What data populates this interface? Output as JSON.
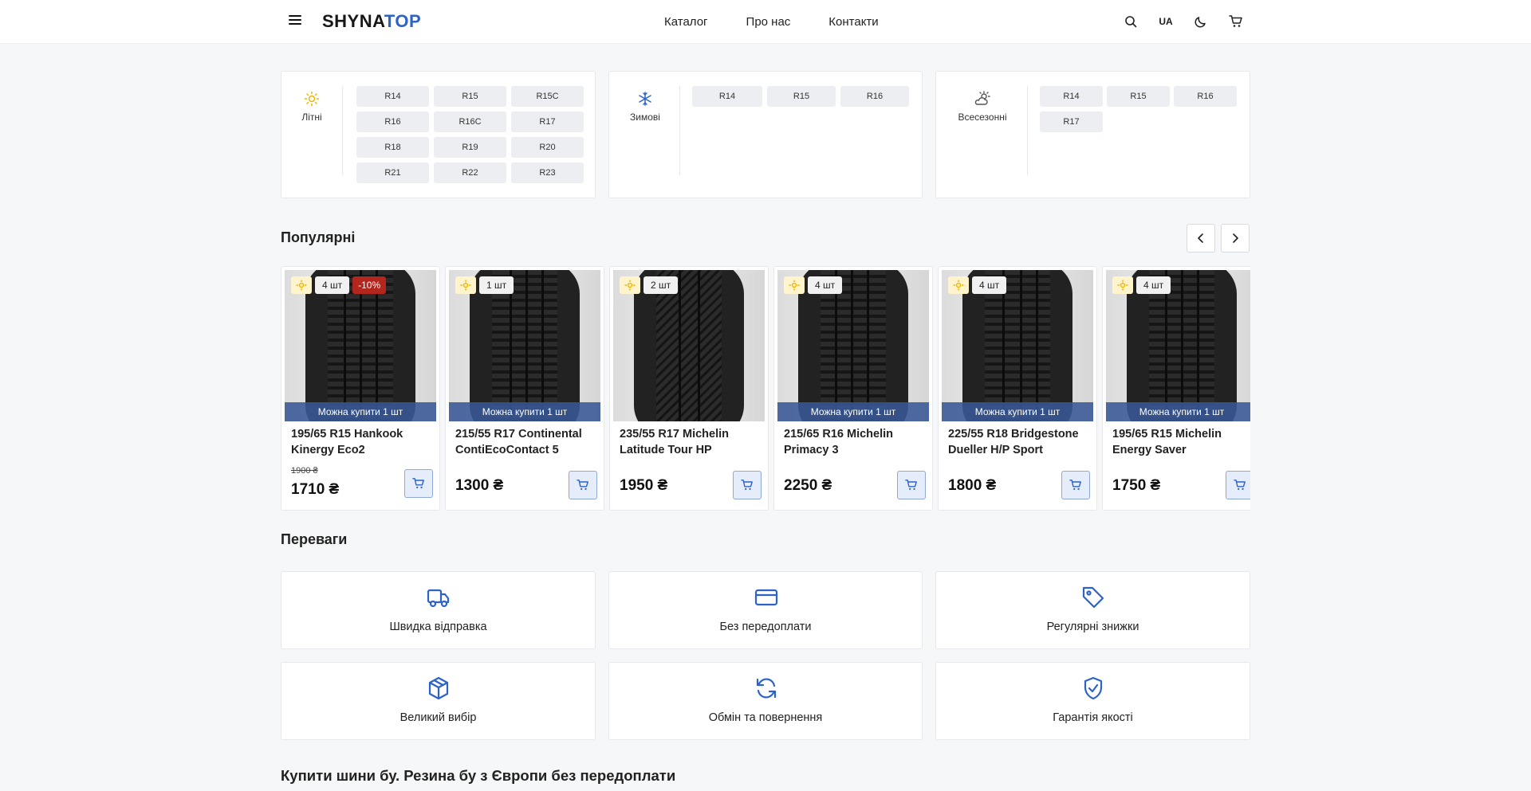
{
  "header": {
    "logo_part1": "SHYNA",
    "logo_part2": "TOP",
    "nav": [
      "Каталог",
      "Про нас",
      "Контакти"
    ],
    "lang": "UA"
  },
  "sizes": {
    "summer": {
      "label": "Літні",
      "icon": "sun-icon",
      "items": [
        "R14",
        "R15",
        "R15C",
        "R16",
        "R16C",
        "R17",
        "R18",
        "R19",
        "R20",
        "R21",
        "R22",
        "R23"
      ]
    },
    "winter": {
      "label": "Зимові",
      "icon": "snowflake-icon",
      "items": [
        "R14",
        "R15",
        "R16"
      ]
    },
    "allseason": {
      "label": "Всесезонні",
      "icon": "sun-cloud-icon",
      "items": [
        "R14",
        "R15",
        "R16",
        "R17"
      ]
    }
  },
  "popular": {
    "title": "Популярні",
    "buy_one_label": "Можна купити 1 шт",
    "products": [
      {
        "name": "195/65 R15 Hankook Kinergy Eco2",
        "qty": "4 шт",
        "discount": "-10%",
        "old_price": "1900 ₴",
        "price": "1710 ₴"
      },
      {
        "name": "215/55 R17 Continental ContiEcoContact 5",
        "qty": "1 шт",
        "discount": "",
        "old_price": "",
        "price": "1300 ₴"
      },
      {
        "name": "235/55 R17 Michelin Latitude Tour HP",
        "qty": "2 шт",
        "discount": "",
        "old_price": "",
        "price": "1950 ₴"
      },
      {
        "name": "215/65 R16 Michelin Primacy 3",
        "qty": "4 шт",
        "discount": "",
        "old_price": "",
        "price": "2250 ₴"
      },
      {
        "name": "225/55 R18 Bridgestone Dueller H/P Sport",
        "qty": "4 шт",
        "discount": "",
        "old_price": "",
        "price": "1800 ₴"
      },
      {
        "name": "195/65 R15 Michelin Energy Saver",
        "qty": "4 шт",
        "discount": "",
        "old_price": "",
        "price": "1750 ₴"
      }
    ]
  },
  "advantages": {
    "title": "Переваги",
    "items": [
      {
        "label": "Швидка відправка",
        "icon": "truck-icon"
      },
      {
        "label": "Без передоплати",
        "icon": "credit-card-icon"
      },
      {
        "label": "Регулярні знижки",
        "icon": "tag-icon"
      },
      {
        "label": "Великий вибір",
        "icon": "box-icon"
      },
      {
        "label": "Обмін та повернення",
        "icon": "refresh-icon"
      },
      {
        "label": "Гарантія якості",
        "icon": "shield-check-icon"
      }
    ]
  },
  "seo_title": "Купити шини бу. Резина бу з Європи без передоплати",
  "colors": {
    "accent": "#2d63c8",
    "discount": "#b3261e",
    "sun": "#f0b400",
    "overlay": "#385896"
  }
}
